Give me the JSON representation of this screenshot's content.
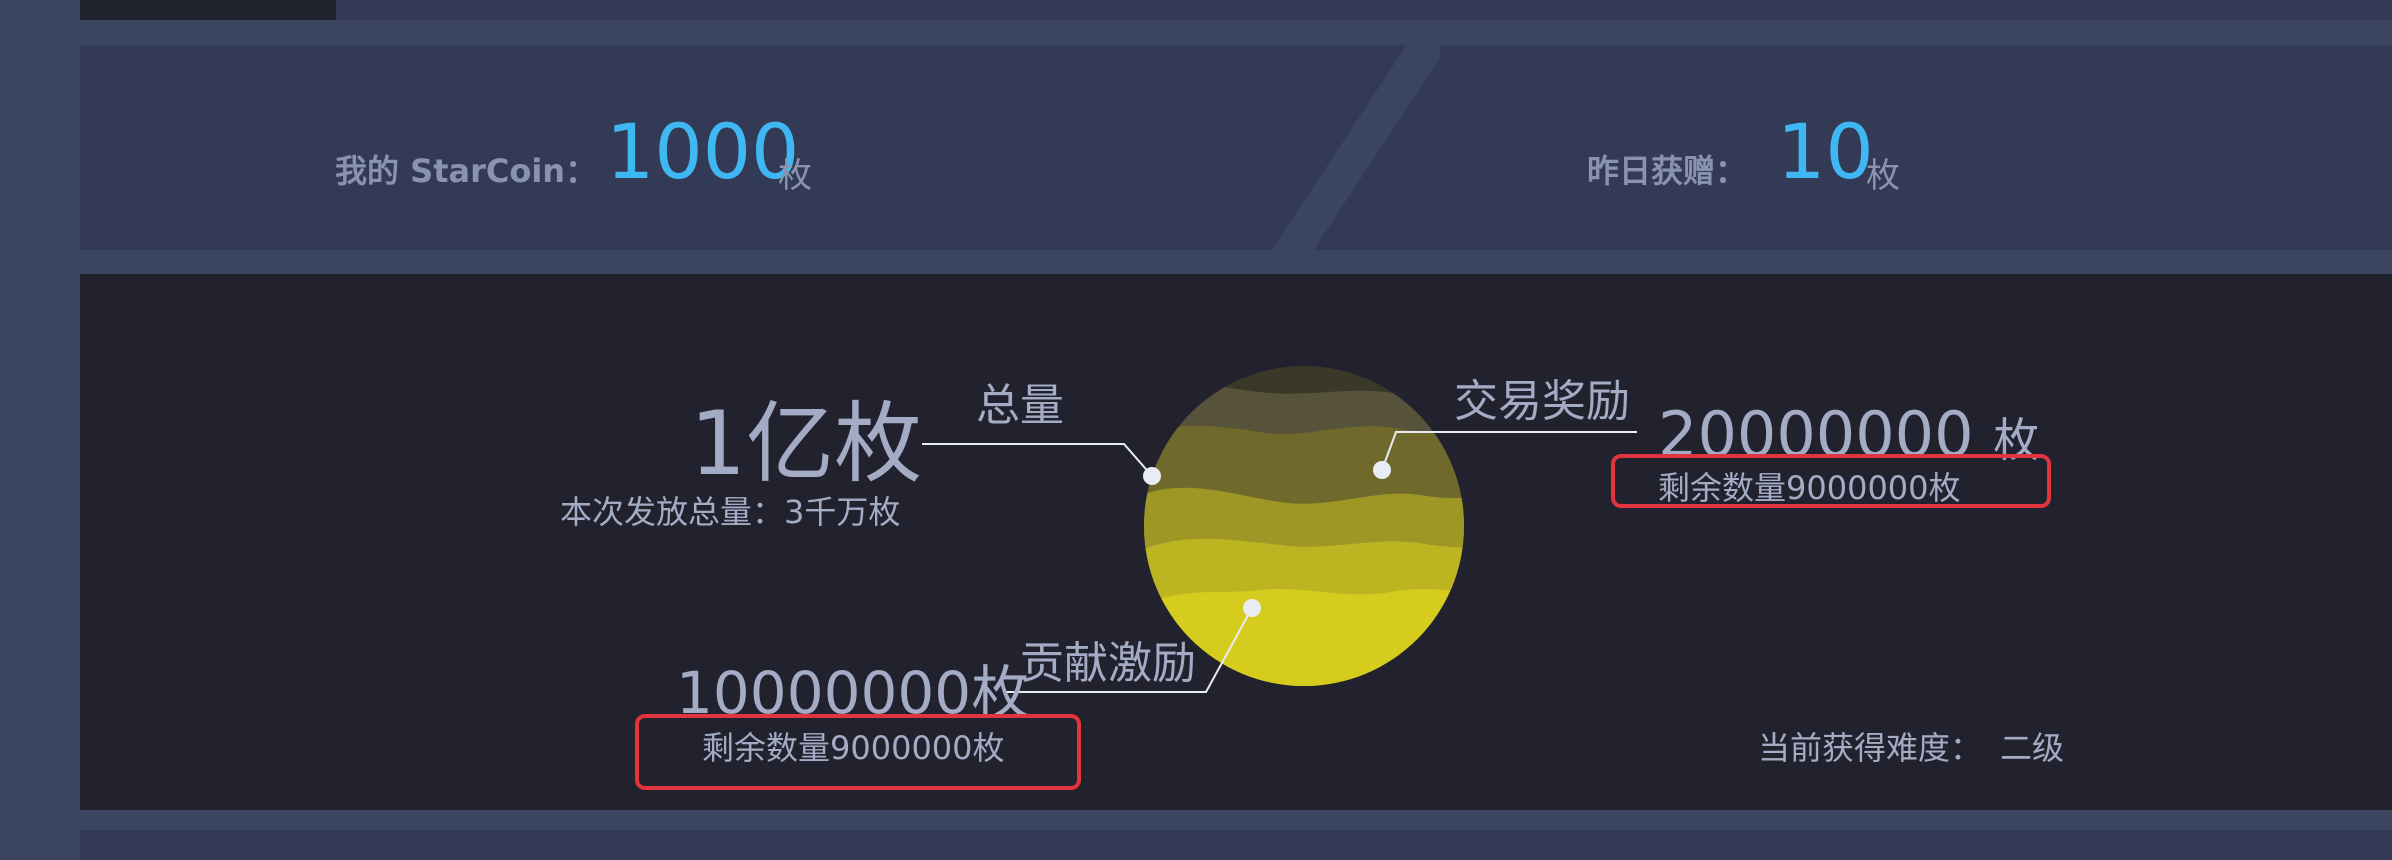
{
  "stats": {
    "my_label": "我的 StarCoin：",
    "my_value": "1000",
    "my_unit": "枚",
    "yesterday_label": "昨日获赠：",
    "yesterday_value": "10",
    "yesterday_unit": "枚"
  },
  "distribution": {
    "total_label": "总量",
    "total_value": "1亿枚",
    "issued_note": "本次发放总量：3千万枚",
    "trade_label": "交易奖励",
    "trade_value": "20000000",
    "trade_unit": "枚",
    "trade_remaining": "剩余数量9000000枚",
    "contrib_label": "贡献激励",
    "contrib_value": "10000000枚",
    "contrib_remaining": "剩余数量9000000枚",
    "difficulty_label": "当前获得难度：",
    "difficulty_value": "二级"
  },
  "colors": {
    "accent_blue": "#3fb7f2",
    "highlight_red": "#e1343f",
    "sphere_top": "#4e4a33",
    "sphere_bottom": "#d8ce1e"
  }
}
